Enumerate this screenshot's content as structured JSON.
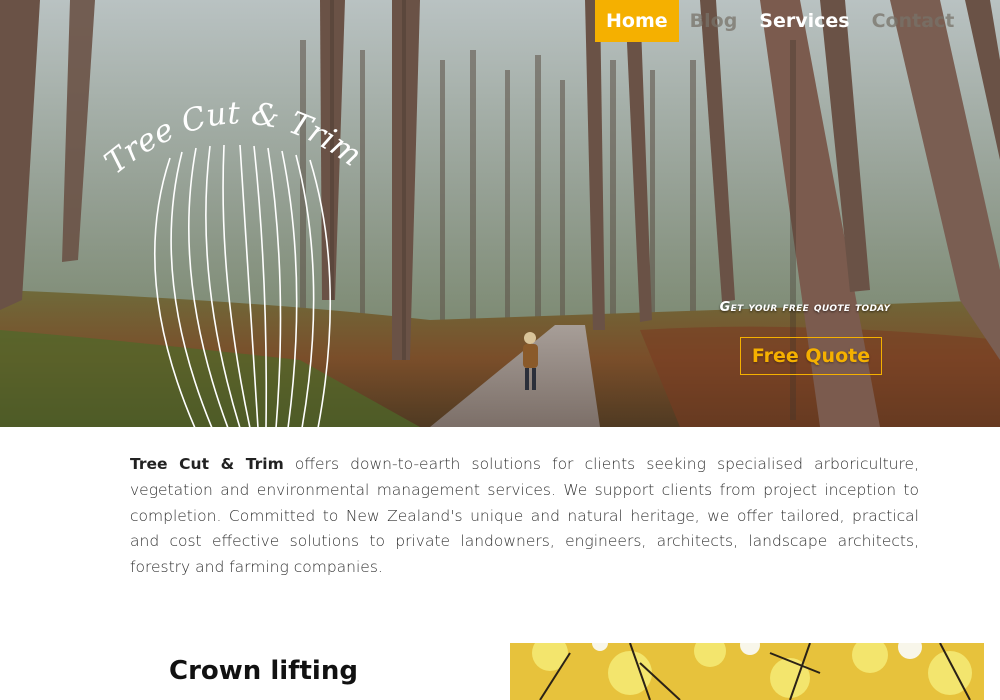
{
  "nav": {
    "items": [
      {
        "label": "Home",
        "state": "active"
      },
      {
        "label": "Blog",
        "state": "muted"
      },
      {
        "label": "Services",
        "state": "normal"
      },
      {
        "label": "Contact",
        "state": "muted"
      }
    ],
    "active_color": "#f5b000"
  },
  "hero": {
    "logo_text": "Tree Cut & Trim",
    "image": "forest-path-photo",
    "cta": {
      "tagline": "Get your free quote today",
      "button_label": "Free Quote",
      "color": "#f5b000"
    }
  },
  "intro": {
    "brand": "Tree Cut & Trim",
    "text": " offers down-to-earth solutions for clients seeking specialised arboriculture, vegetation and environmental management services. We support clients from project inception to completion. Committed to New Zealand's unique and natural heritage, we offer tailored, practical and cost effective solutions to private landowners, engineers, architects, landscape architects, forestry and farming companies."
  },
  "services": [
    {
      "title": "Crown lifting",
      "image": "yellow-autumn-canopy-photo"
    }
  ]
}
